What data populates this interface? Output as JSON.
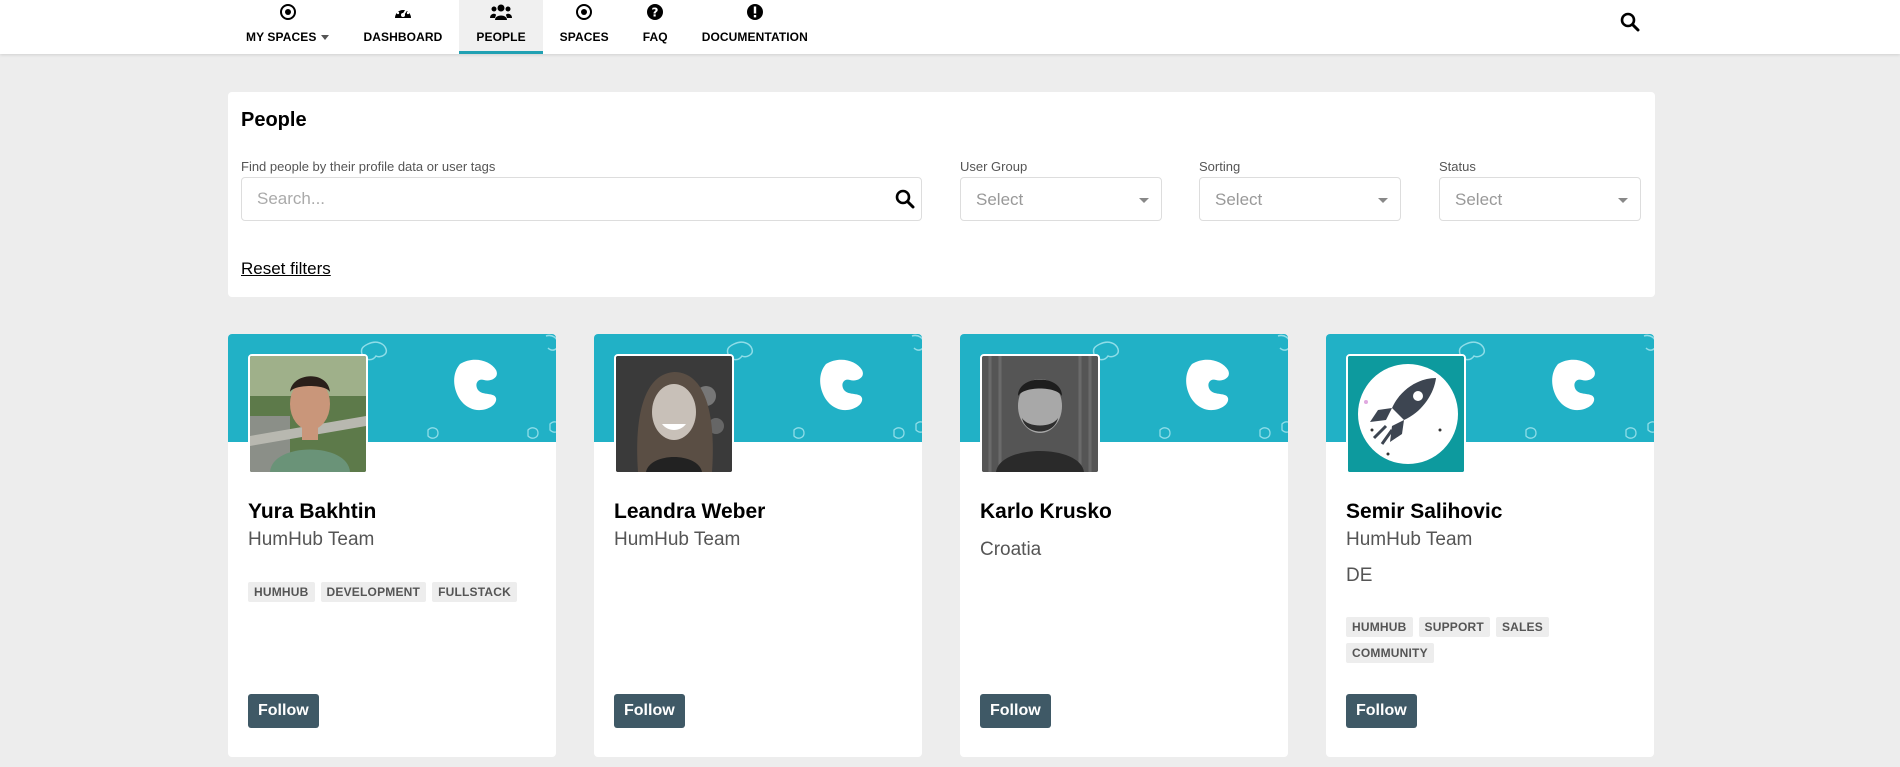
{
  "nav": {
    "items": [
      {
        "label": "MY SPACES",
        "icon": "target-icon"
      },
      {
        "label": "DASHBOARD",
        "icon": "dashboard-icon"
      },
      {
        "label": "PEOPLE",
        "icon": "users-icon"
      },
      {
        "label": "SPACES",
        "icon": "target-icon"
      },
      {
        "label": "FAQ",
        "icon": "question-icon"
      },
      {
        "label": "DOCUMENTATION",
        "icon": "exclamation-icon"
      }
    ],
    "active": "PEOPLE",
    "accent": "#21a1b3"
  },
  "filters": {
    "title": "People",
    "search_label": "Find people by their profile data or user tags",
    "search_placeholder": "Search...",
    "user_group_label": "User Group",
    "user_group_value": "Select",
    "sorting_label": "Sorting",
    "sorting_value": "Select",
    "status_label": "Status",
    "status_value": "Select",
    "reset_label": "Reset filters"
  },
  "cards": [
    {
      "name": "Yura Bakhtin",
      "line1": "HumHub Team",
      "line2": "",
      "tags": [
        "HUMHUB",
        "DEVELOPMENT",
        "FULLSTACK"
      ],
      "follow": "Follow"
    },
    {
      "name": "Leandra Weber",
      "line1": "HumHub Team",
      "line2": "",
      "tags": [],
      "follow": "Follow"
    },
    {
      "name": "Karlo Krusko",
      "line1": "",
      "line2": "Croatia",
      "tags": [],
      "follow": "Follow"
    },
    {
      "name": "Semir Salihovic",
      "line1": "HumHub Team",
      "line2": "DE",
      "tags": [
        "HUMHUB",
        "SUPPORT",
        "SALES",
        "COMMUNITY"
      ],
      "follow": "Follow"
    }
  ],
  "colors": {
    "banner": "#21b1c6",
    "follow_button": "#3f5966",
    "page_bg": "#ededed"
  }
}
